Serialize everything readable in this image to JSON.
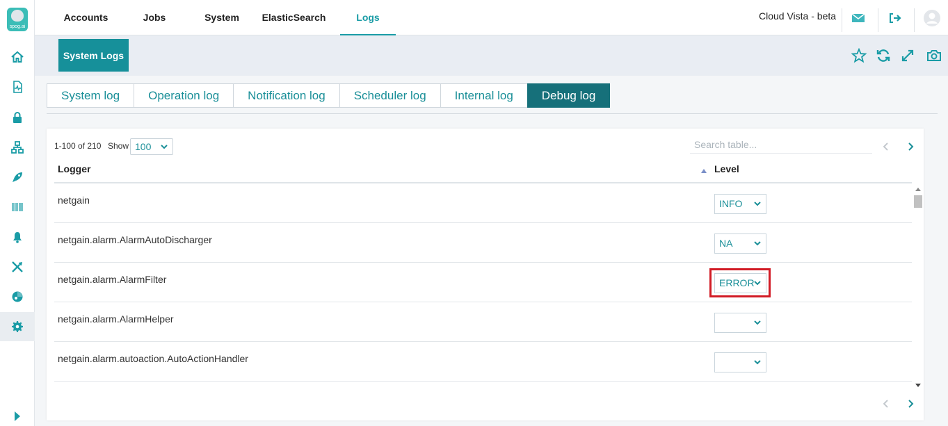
{
  "sidebar": {
    "logo_text": "spog.ai",
    "items": [
      {
        "name": "home-icon"
      },
      {
        "name": "report-icon"
      },
      {
        "name": "lock-icon"
      },
      {
        "name": "network-icon"
      },
      {
        "name": "rocket-icon"
      },
      {
        "name": "barcode-icon"
      },
      {
        "name": "alarm-bell-icon"
      },
      {
        "name": "tools-icon"
      },
      {
        "name": "dashboard-pie-icon"
      },
      {
        "name": "settings-gear-icon"
      }
    ],
    "expand_icon": "caret-right-icon"
  },
  "topnav": {
    "tabs": [
      {
        "label": "Accounts"
      },
      {
        "label": "Jobs"
      },
      {
        "label": "System"
      },
      {
        "label": "ElasticSearch"
      },
      {
        "label": "Logs"
      }
    ],
    "active_tab": "Logs",
    "brand": "Cloud Vista - beta"
  },
  "subheader": {
    "title": "System Logs",
    "tools": [
      "star-icon",
      "refresh-icon",
      "expand-icon",
      "camera-icon"
    ]
  },
  "log_tabs": [
    {
      "label": "System log"
    },
    {
      "label": "Operation log"
    },
    {
      "label": "Notification log"
    },
    {
      "label": "Scheduler log"
    },
    {
      "label": "Internal log"
    },
    {
      "label": "Debug log"
    }
  ],
  "active_log_tab": "Debug log",
  "table": {
    "range_text": "1-100 of 210",
    "show_label": "Show",
    "show_value": "100",
    "search_placeholder": "Search table...",
    "columns": {
      "logger": "Logger",
      "level": "Level"
    },
    "rows": [
      {
        "logger": "netgain",
        "level": "INFO"
      },
      {
        "logger": "netgain.alarm.AlarmAutoDischarger",
        "level": "NA"
      },
      {
        "logger": "netgain.alarm.AlarmFilter",
        "level": "ERROR"
      },
      {
        "logger": "netgain.alarm.AlarmHelper",
        "level": ""
      },
      {
        "logger": "netgain.alarm.autoaction.AutoActionHandler",
        "level": ""
      }
    ]
  },
  "colors": {
    "accent": "#1a9ca6",
    "active_tab_bg": "#16707a",
    "title_bg": "#16909a",
    "highlight": "#d11a24"
  }
}
